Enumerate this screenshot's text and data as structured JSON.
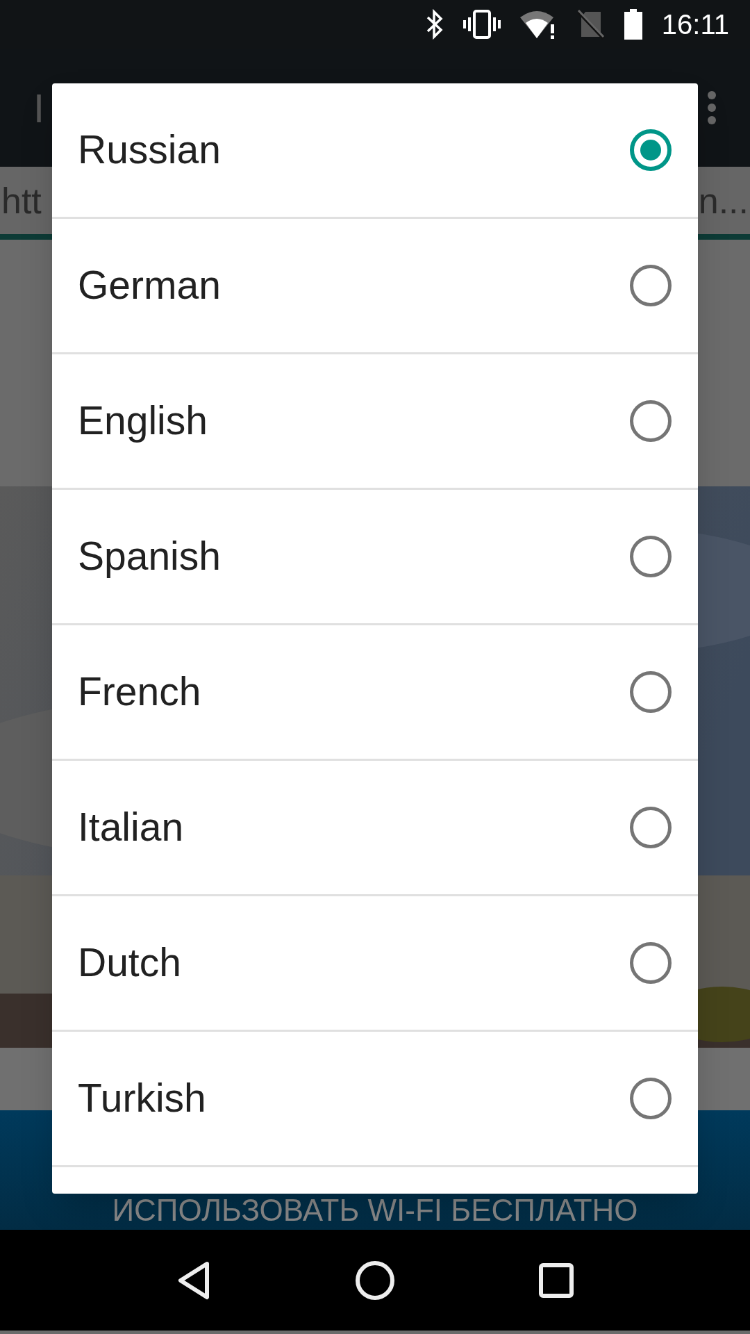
{
  "status_bar": {
    "time": "16:11"
  },
  "app_bar": {
    "title": "I"
  },
  "url_bar": {
    "start": "htt",
    "end": "n..."
  },
  "banner": {
    "button": "ИСПОЛЬЗОВАТЬ WI-FI БЕСПЛАТНО"
  },
  "dialog": {
    "options": [
      {
        "label": "Russian",
        "selected": true
      },
      {
        "label": "German",
        "selected": false
      },
      {
        "label": "English",
        "selected": false
      },
      {
        "label": "Spanish",
        "selected": false
      },
      {
        "label": "French",
        "selected": false
      },
      {
        "label": "Italian",
        "selected": false
      },
      {
        "label": "Dutch",
        "selected": false
      },
      {
        "label": "Turkish",
        "selected": false
      }
    ]
  }
}
